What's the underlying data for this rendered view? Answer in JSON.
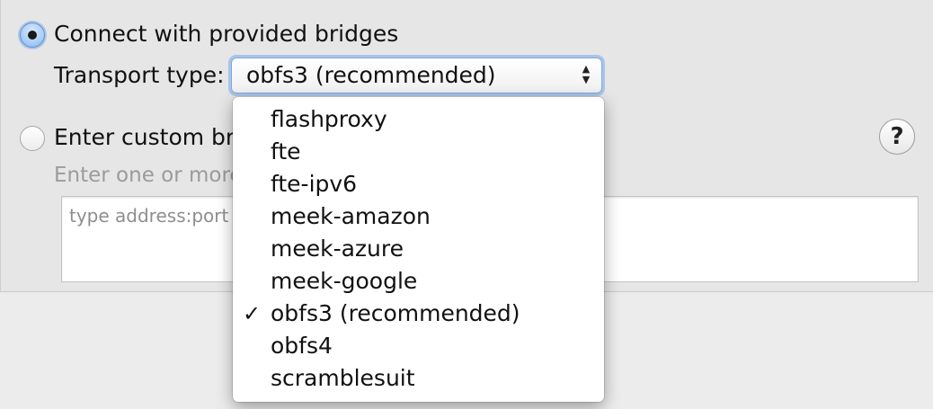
{
  "options": {
    "provided_label": "Connect with provided bridges",
    "transport_label": "Transport type:",
    "custom_label": "Enter custom bridges",
    "custom_hint": "Enter one or more bridge relays (one per line).",
    "custom_placeholder": "type address:port"
  },
  "transport_popup": {
    "selected": "obfs3 (recommended)",
    "arrows_up": "▲",
    "arrows_down": "▼"
  },
  "help_button": {
    "label": "?"
  },
  "menu": {
    "checkmark": "✓",
    "items": [
      {
        "label": "flashproxy"
      },
      {
        "label": "fte"
      },
      {
        "label": "fte-ipv6"
      },
      {
        "label": "meek-amazon"
      },
      {
        "label": "meek-azure"
      },
      {
        "label": "meek-google"
      },
      {
        "label": "obfs3 (recommended)"
      },
      {
        "label": "obfs4"
      },
      {
        "label": "scramblesuit"
      }
    ]
  },
  "colors": {
    "accent": "#7ea9e4",
    "panel": "#e6e6e6",
    "muted_text": "#9b9b9b"
  }
}
